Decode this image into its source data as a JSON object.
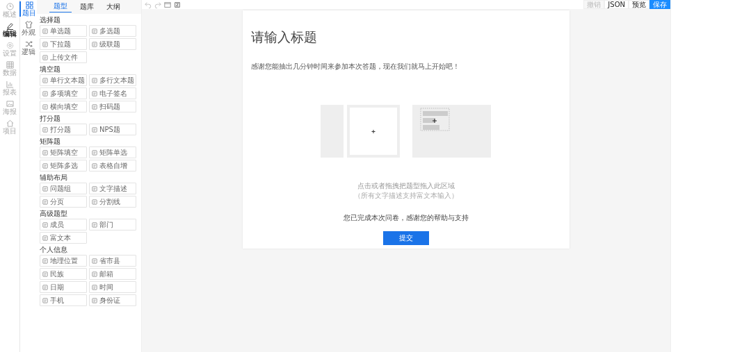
{
  "nav": [
    {
      "label": "概述",
      "selected": false
    },
    {
      "label": "编辑",
      "selected": true
    },
    {
      "label": "设置",
      "selected": false
    },
    {
      "label": "数据",
      "selected": false
    },
    {
      "label": "报表",
      "selected": false
    },
    {
      "label": "海报",
      "selected": false
    },
    {
      "label": "项目",
      "selected": false
    }
  ],
  "subnav": [
    {
      "label": "题目",
      "selected": true
    },
    {
      "label": "外观",
      "selected": false
    },
    {
      "label": "逻辑",
      "selected": false
    }
  ],
  "panel_tabs": [
    {
      "label": "题型",
      "selected": true
    },
    {
      "label": "题库",
      "selected": false
    },
    {
      "label": "大纲",
      "selected": false
    }
  ],
  "groups": [
    {
      "title": "选择题",
      "items": [
        "单选题",
        "多选题",
        "下拉题",
        "级联题",
        "上传文件"
      ]
    },
    {
      "title": "填空题",
      "items": [
        "单行文本题",
        "多行文本题",
        "多项填空",
        "电子签名",
        "横向填空",
        "扫码题"
      ]
    },
    {
      "title": "打分题",
      "items": [
        "打分题",
        "NPS题"
      ]
    },
    {
      "title": "矩阵题",
      "items": [
        "矩阵填空",
        "矩阵单选",
        "矩阵多选",
        "表格自增"
      ]
    },
    {
      "title": "辅助布局",
      "items": [
        "问题组",
        "文字描述",
        "分页",
        "分割线"
      ]
    },
    {
      "title": "高级题型",
      "items": [
        "成员",
        "部门",
        "富文本"
      ]
    },
    {
      "title": "个人信息",
      "items": [
        "地理位置",
        "省市县",
        "民族",
        "邮箱",
        "日期",
        "时间",
        "手机",
        "身份证"
      ]
    }
  ],
  "toolbar": {
    "actions": [
      {
        "label": "撤销",
        "kind": "plain",
        "disabled": true
      },
      {
        "label": "JSON",
        "kind": "plain",
        "disabled": false
      },
      {
        "label": "预览",
        "kind": "plain",
        "disabled": false
      },
      {
        "label": "保存",
        "kind": "primary",
        "disabled": false
      }
    ]
  },
  "survey": {
    "title": "请输入标题",
    "intro": "感谢您能抽出几分钟时间来参加本次答题，现在我们就马上开始吧！",
    "drop_hint": "点击或者拖拽把题型拖入此区域",
    "drop_note": "（所有文字描述支持富文本输入）",
    "end_text": "您已完成本次问卷，感谢您的帮助与支持",
    "submit": "提交"
  }
}
